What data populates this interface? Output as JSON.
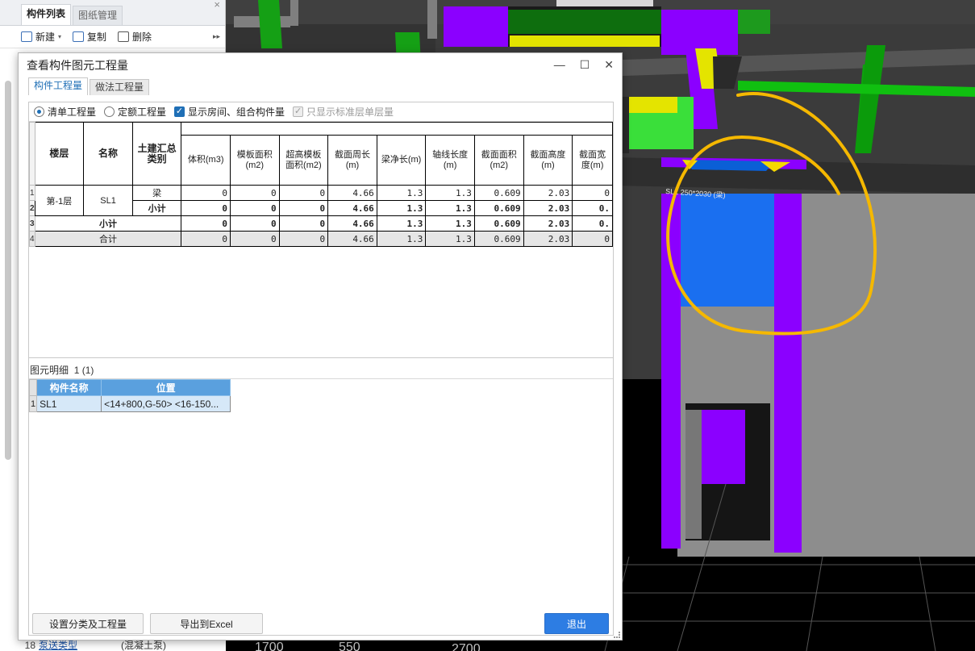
{
  "left_panel": {
    "tabs": [
      "构件列表",
      "图纸管理"
    ],
    "close_glyph": "×",
    "toolbar": {
      "new_label": "新建",
      "copy_label": "复制",
      "delete_label": "删除"
    },
    "bottom_row": {
      "num": "18",
      "key": "泵送类型",
      "value": "(混凝土泵)"
    }
  },
  "dialog": {
    "title": "查看构件图元工程量",
    "tabs": [
      "构件工程量",
      "做法工程量"
    ],
    "options": {
      "radio_bill": "清单工程量",
      "radio_quota": "定额工程量",
      "chk_show_rooms": "显示房间、组合构件量",
      "chk_std_floor": "只显示标准层单层量"
    },
    "table": {
      "headers": {
        "floor": "楼层",
        "name": "名称",
        "category": "土建汇总类别",
        "cols": [
          "体积(m3)",
          "模板面积(m2)",
          "超高模板面积(m2)",
          "截面周长(m)",
          "梁净长(m)",
          "轴线长度(m)",
          "截面面积(m2)",
          "截面高度(m)",
          "截面宽度(m)"
        ]
      },
      "rows": [
        {
          "rn": "1",
          "category": "梁",
          "values": [
            "0",
            "0",
            "0",
            "4.66",
            "1.3",
            "1.3",
            "0.609",
            "2.03",
            "0"
          ]
        },
        {
          "rn": "2",
          "category": "小计",
          "values": [
            "0",
            "0",
            "0",
            "4.66",
            "1.3",
            "1.3",
            "0.609",
            "2.03",
            "0."
          ]
        },
        {
          "rn": "3",
          "label": "小计",
          "values": [
            "0",
            "0",
            "0",
            "4.66",
            "1.3",
            "1.3",
            "0.609",
            "2.03",
            "0."
          ]
        },
        {
          "rn": "4",
          "label": "合计",
          "values": [
            "0",
            "0",
            "0",
            "4.66",
            "1.3",
            "1.3",
            "0.609",
            "2.03",
            "0"
          ]
        }
      ],
      "floor_value": "第-1层",
      "name_value": "SL1"
    },
    "detail": {
      "title": "图元明细",
      "count": "1 (1)",
      "headers": [
        "构件名称",
        "位置"
      ],
      "rows": [
        {
          "rn": "1",
          "name": "SL1",
          "position": "<14+800,G-50> <16-150..."
        }
      ]
    },
    "buttons": {
      "settings": "设置分类及工程量",
      "export": "导出到Excel",
      "exit": "退出"
    }
  },
  "viewport": {
    "bottom_labels": [
      "1700",
      "550",
      "2700"
    ],
    "dim_text": "SL1 250*2030 (梁)"
  },
  "colors": {
    "accent": "#2d7de3",
    "purple": "#8b00ff",
    "green": "#22b022",
    "annotation": "#f5b800"
  }
}
